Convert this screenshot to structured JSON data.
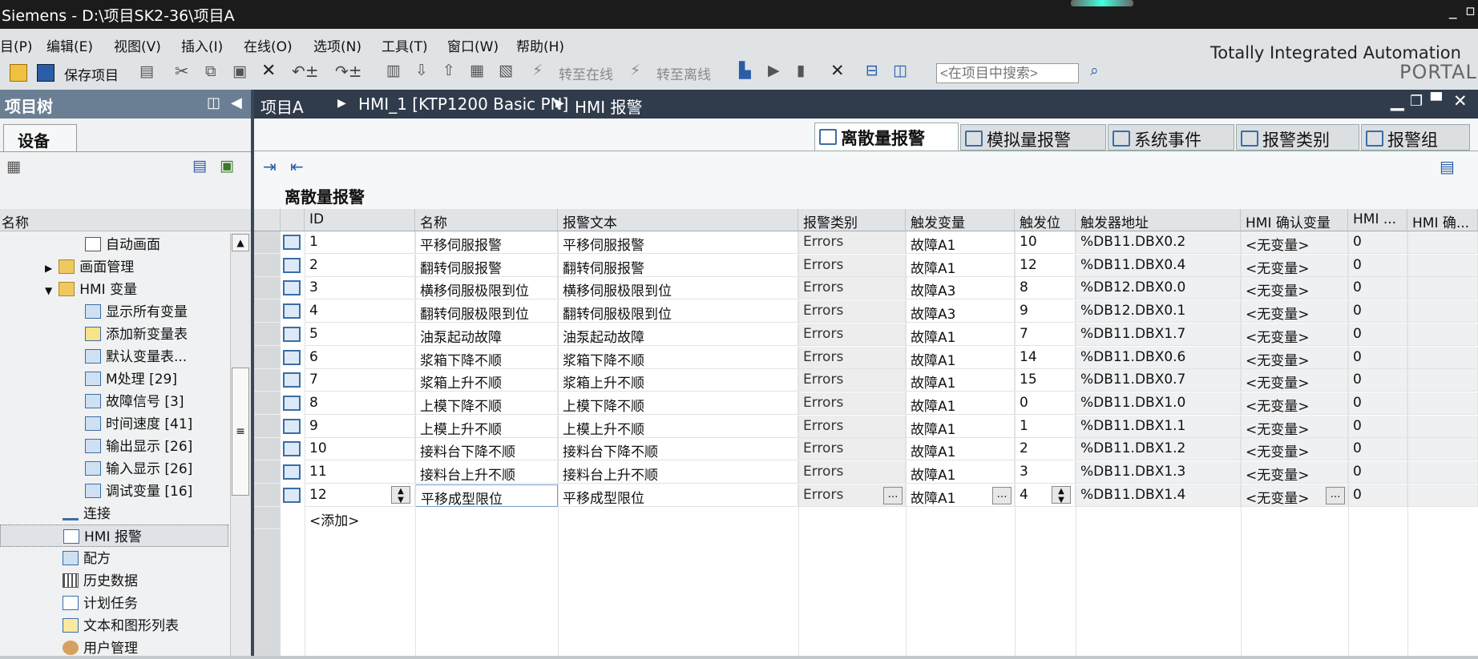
{
  "window": {
    "title": "Siemens  -  D:\\项目SK2-36\\项目A"
  },
  "menu": [
    "目(P)",
    "编辑(E)",
    "视图(V)",
    "插入(I)",
    "在线(O)",
    "选项(N)",
    "工具(T)",
    "窗口(W)",
    "帮助(H)"
  ],
  "toolbar": {
    "save": "保存项目",
    "go_online": "转至在线",
    "go_offline": "转至离线",
    "search_placeholder": "<在项目中搜索>"
  },
  "brand": {
    "line1": "Totally Integrated Automation",
    "line2": "PORTAL"
  },
  "project_tree": {
    "title": "项目树",
    "tab": "设备",
    "column": "名称",
    "items": [
      {
        "label": "自动画面",
        "icon": "screen-icon",
        "level": 4
      },
      {
        "label": "画面管理",
        "icon": "folder-icon",
        "level": 3,
        "expand": "collapsed"
      },
      {
        "label": "HMI 变量",
        "icon": "folder-icon",
        "level": 3,
        "expand": "expanded"
      },
      {
        "label": "显示所有变量",
        "icon": "tag-table-icon",
        "level": 4
      },
      {
        "label": "添加新变量表",
        "icon": "add-tag-table-icon",
        "level": 4
      },
      {
        "label": "默认变量表...",
        "icon": "tag-table-icon",
        "level": 4
      },
      {
        "label": "M处理 [29]",
        "icon": "tag-table-icon",
        "level": 4
      },
      {
        "label": "故障信号 [3]",
        "icon": "tag-table-icon",
        "level": 4
      },
      {
        "label": "时间速度 [41]",
        "icon": "tag-table-icon",
        "level": 4
      },
      {
        "label": "输出显示 [26]",
        "icon": "tag-table-icon",
        "level": 4
      },
      {
        "label": "输入显示 [26]",
        "icon": "tag-table-icon",
        "level": 4
      },
      {
        "label": "调试变量 [16]",
        "icon": "tag-table-icon",
        "level": 4
      },
      {
        "label": "连接",
        "icon": "connection-icon",
        "level": 3
      },
      {
        "label": "HMI 报警",
        "icon": "alarm-icon",
        "level": 3,
        "selected": true
      },
      {
        "label": "配方",
        "icon": "recipe-icon",
        "level": 3
      },
      {
        "label": "历史数据",
        "icon": "history-icon",
        "level": 3
      },
      {
        "label": "计划任务",
        "icon": "schedule-icon",
        "level": 3
      },
      {
        "label": "文本和图形列表",
        "icon": "text-list-icon",
        "level": 3
      },
      {
        "label": "用户管理",
        "icon": "user-icon",
        "level": 3
      }
    ]
  },
  "breadcrumb": [
    "项目A",
    "HMI_1 [KTP1200 Basic PN]",
    "HMI 报警"
  ],
  "tabs": [
    {
      "label": "离散量报警",
      "active": true
    },
    {
      "label": "模拟量报警"
    },
    {
      "label": "系统事件"
    },
    {
      "label": "报警类别"
    },
    {
      "label": "报警组"
    }
  ],
  "section_title": "离散量报警",
  "columns": [
    "ID",
    "名称",
    "报警文本",
    "报警类别",
    "触发变量",
    "触发位",
    "触发器地址",
    "HMI 确认变量",
    "HMI ...",
    "HMI 确..."
  ],
  "rows": [
    {
      "id": "1",
      "name": "平移伺服报警",
      "text": "平移伺服报警",
      "class": "Errors",
      "var": "故障A1",
      "bit": "10",
      "addr": "%DB11.DBX0.2",
      "ack": "<无变量>",
      "hmi": "0"
    },
    {
      "id": "2",
      "name": "翻转伺服报警",
      "text": "翻转伺服报警",
      "class": "Errors",
      "var": "故障A1",
      "bit": "12",
      "addr": "%DB11.DBX0.4",
      "ack": "<无变量>",
      "hmi": "0"
    },
    {
      "id": "3",
      "name": "横移伺服极限到位",
      "text": "横移伺服极限到位",
      "class": "Errors",
      "var": "故障A3",
      "bit": "8",
      "addr": "%DB12.DBX0.0",
      "ack": "<无变量>",
      "hmi": "0"
    },
    {
      "id": "4",
      "name": "翻转伺服极限到位",
      "text": "翻转伺服极限到位",
      "class": "Errors",
      "var": "故障A3",
      "bit": "9",
      "addr": "%DB12.DBX0.1",
      "ack": "<无变量>",
      "hmi": "0"
    },
    {
      "id": "5",
      "name": "油泵起动故障",
      "text": "油泵起动故障",
      "class": "Errors",
      "var": "故障A1",
      "bit": "7",
      "addr": "%DB11.DBX1.7",
      "ack": "<无变量>",
      "hmi": "0"
    },
    {
      "id": "6",
      "name": "浆箱下降不顺",
      "text": "浆箱下降不顺",
      "class": "Errors",
      "var": "故障A1",
      "bit": "14",
      "addr": "%DB11.DBX0.6",
      "ack": "<无变量>",
      "hmi": "0"
    },
    {
      "id": "7",
      "name": "浆箱上升不顺",
      "text": "浆箱上升不顺",
      "class": "Errors",
      "var": "故障A1",
      "bit": "15",
      "addr": "%DB11.DBX0.7",
      "ack": "<无变量>",
      "hmi": "0"
    },
    {
      "id": "8",
      "name": "上模下降不顺",
      "text": "上模下降不顺",
      "class": "Errors",
      "var": "故障A1",
      "bit": "0",
      "addr": "%DB11.DBX1.0",
      "ack": "<无变量>",
      "hmi": "0"
    },
    {
      "id": "9",
      "name": "上模上升不顺",
      "text": "上模上升不顺",
      "class": "Errors",
      "var": "故障A1",
      "bit": "1",
      "addr": "%DB11.DBX1.1",
      "ack": "<无变量>",
      "hmi": "0"
    },
    {
      "id": "10",
      "name": "接料台下降不顺",
      "text": "接料台下降不顺",
      "class": "Errors",
      "var": "故障A1",
      "bit": "2",
      "addr": "%DB11.DBX1.2",
      "ack": "<无变量>",
      "hmi": "0"
    },
    {
      "id": "11",
      "name": "接料台上升不顺",
      "text": "接料台上升不顺",
      "class": "Errors",
      "var": "故障A1",
      "bit": "3",
      "addr": "%DB11.DBX1.3",
      "ack": "<无变量>",
      "hmi": "0"
    },
    {
      "id": "12",
      "name": "平移成型限位",
      "text": "平移成型限位",
      "class": "Errors",
      "var": "故障A1",
      "bit": "4",
      "addr": "%DB11.DBX1.4",
      "ack": "<无变量>",
      "hmi": "0",
      "editing": true
    }
  ],
  "add_row": "<添加>"
}
